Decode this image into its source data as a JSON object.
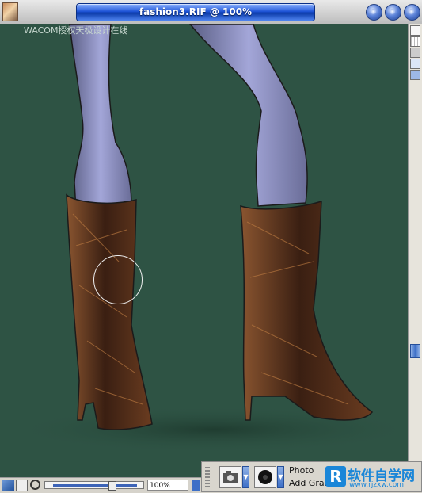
{
  "window": {
    "title": "fashion3.RIF @ 100%"
  },
  "canvas": {
    "background_color": "#2e5344",
    "watermark_text": "WACOM授权天极设计在线",
    "artwork": "fashion sketch of legs in brown high-heeled boots"
  },
  "status_bar": {
    "zoom_value": "100%",
    "zoom_level": 1.0
  },
  "brush_panel": {
    "category": "Photo",
    "variant": "Add Grain"
  },
  "site_logo": {
    "mark": "R",
    "name": "软件自学网",
    "url": "www.rjzxw.com"
  },
  "colors": {
    "title_bar_blue": "#1f55d8",
    "logo_blue": "#1a86d8",
    "boot_brown": "#7a4a28"
  },
  "icons": [
    "app-painter-icon",
    "minimize-icon",
    "maximize-icon",
    "close-icon",
    "layers-icon",
    "grid-icon",
    "tracing-icon",
    "settings-icon",
    "scroll-up-icon",
    "layers-adjuster-icon",
    "grabber-hand-icon",
    "magnifier-icon",
    "camera-icon",
    "brush-dab-icon"
  ]
}
